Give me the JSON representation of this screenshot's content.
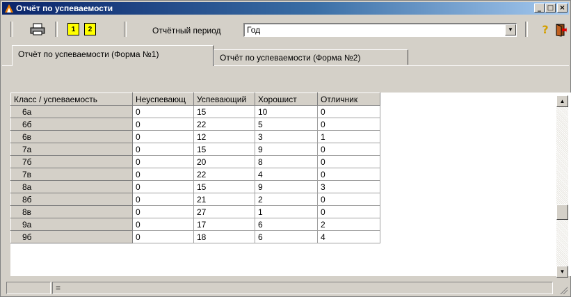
{
  "window": {
    "title": "Отчёт по успеваемости",
    "minimize_label": "_",
    "maximize_label": "□",
    "close_label": "×"
  },
  "toolbar": {
    "page1_label": "1",
    "page2_label": "2",
    "period_label": "Отчётный период",
    "period_value": "Год",
    "help_label": "?"
  },
  "tabs": [
    {
      "label": "Отчёт по успеваемости (Форма №1)",
      "active": true
    },
    {
      "label": "Отчёт по успеваемости (Форма №2)",
      "active": false
    }
  ],
  "grid": {
    "columns": [
      "Класс / успеваемость",
      "Неуспевающ",
      "Успевающий",
      "Хорошист",
      "Отличник"
    ],
    "rows": [
      [
        "6а",
        "0",
        "15",
        "10",
        "0"
      ],
      [
        "6б",
        "0",
        "22",
        "5",
        "0"
      ],
      [
        "6в",
        "0",
        "12",
        "3",
        "1"
      ],
      [
        "7а",
        "0",
        "15",
        "9",
        "0"
      ],
      [
        "7б",
        "0",
        "20",
        "8",
        "0"
      ],
      [
        "7в",
        "0",
        "22",
        "4",
        "0"
      ],
      [
        "8а",
        "0",
        "15",
        "9",
        "3"
      ],
      [
        "8б",
        "0",
        "21",
        "2",
        "0"
      ],
      [
        "8в",
        "0",
        "27",
        "1",
        "0"
      ],
      [
        "9а",
        "0",
        "17",
        "6",
        "2"
      ],
      [
        "9б",
        "0",
        "18",
        "6",
        "4"
      ]
    ]
  },
  "status": {
    "panel2": "="
  }
}
